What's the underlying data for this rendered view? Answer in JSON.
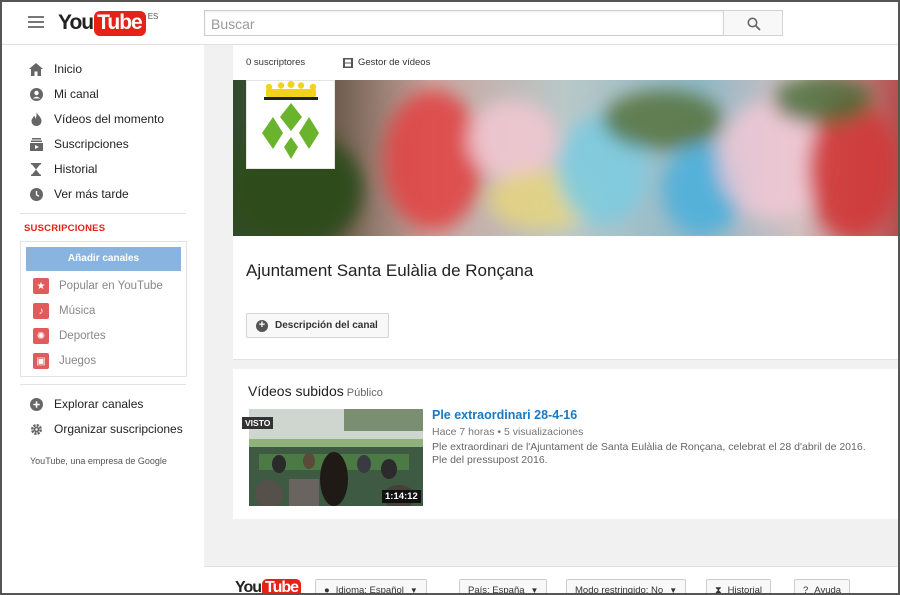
{
  "header": {
    "logo_you": "You",
    "logo_tube": "Tube",
    "country_code": "ES",
    "search_placeholder": "Buscar"
  },
  "sidebar": {
    "items": [
      {
        "label": "Inicio",
        "icon": "home-icon"
      },
      {
        "label": "Mi canal",
        "icon": "account-icon"
      },
      {
        "label": "Vídeos del momento",
        "icon": "flame-icon"
      },
      {
        "label": "Suscripciones",
        "icon": "subscriptions-icon"
      },
      {
        "label": "Historial",
        "icon": "hourglass-icon"
      },
      {
        "label": "Ver más tarde",
        "icon": "clock-icon"
      }
    ],
    "subscriptions_title": "SUSCRIPCIONES",
    "add_channels_label": "Añadir canales",
    "subscriptions": [
      {
        "label": "Popular en YouTube",
        "icon": "star-icon"
      },
      {
        "label": "Música",
        "icon": "music-icon"
      },
      {
        "label": "Deportes",
        "icon": "sports-icon"
      },
      {
        "label": "Juegos",
        "icon": "gamepad-icon"
      }
    ],
    "bottom_items": [
      {
        "label": "Explorar canales",
        "icon": "plus-circle-icon"
      },
      {
        "label": "Organizar suscripciones",
        "icon": "gear-icon"
      }
    ],
    "footnote": "YouTube, una empresa de Google"
  },
  "channel": {
    "subscribers": "0 suscriptores",
    "video_manager": "Gestor de vídeos",
    "name": "Ajuntament Santa Eulàlia de Ronçana",
    "description_button": "Descripción del canal"
  },
  "uploads": {
    "heading": "Vídeos subidos",
    "visibility": "Público",
    "video": {
      "badge": "VISTO",
      "duration": "1:14:12",
      "title": "Ple extraordinari 28-4-16",
      "age": "Hace 7 horas",
      "views": "5 visualizaciones",
      "description_line1": "Ple extraordinari de l'Ajuntament de Santa Eulàlia de Ronçana, celebrat el 28 d'abril de 2016.",
      "description_line2": "Ple del pressupost 2016."
    }
  },
  "footer": {
    "logo_you": "You",
    "logo_tube": "Tube",
    "language": "Idioma: Español",
    "country": "País: España",
    "restricted": "Modo restringido: No",
    "history": "Historial",
    "help": "Ayuda"
  },
  "colors": {
    "brand_red": "#e62117",
    "link_blue": "#167ac6",
    "add_button_blue": "#8ab4e0",
    "logo_green": "#6ab42d",
    "crown_yellow": "#f3d21a"
  }
}
